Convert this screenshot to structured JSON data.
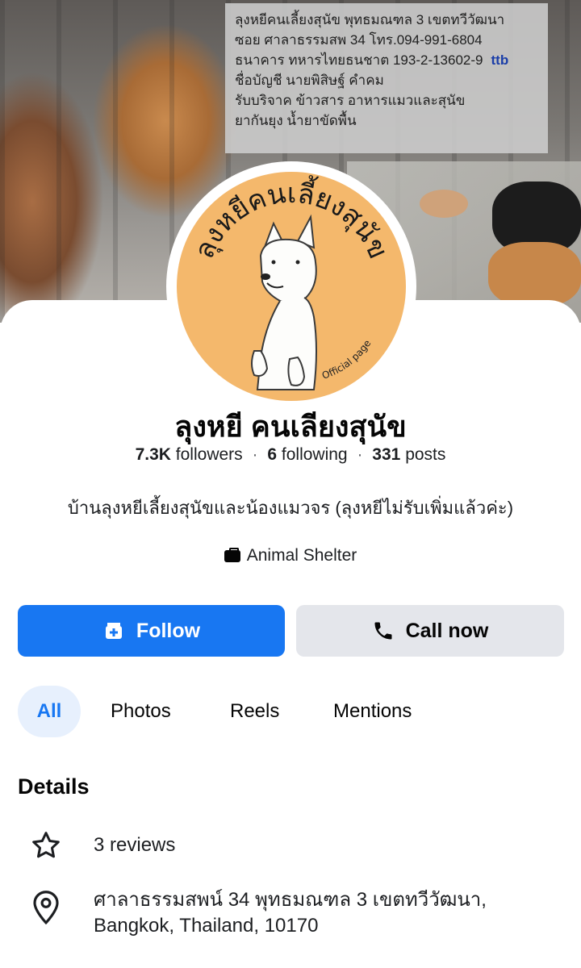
{
  "cover": {
    "lines": [
      "ลุงหยีคนเลี้ยงสุนัข พุทธมณฑล 3 เขตทวีวัฒนา",
      "ซอย ศาลาธรรมสพ 34 โทร.094-991-6804",
      "ธนาคาร ทหารไทยธนชาต 193-2-13602-9",
      "ชื่อบัญชี นายพิสิษฐ์ คำคม",
      "รับบริจาค ข้าวสาร อาหารแมวและสุนัข",
      "ยากันยุง น้ำยาขัดพื้น"
    ],
    "bank_logo": "ttb"
  },
  "avatar": {
    "arc_text": "ลุงหยีคนเลี้ยงสุนัข",
    "badge_text": "Official page",
    "background_color": "#f4b86c"
  },
  "profile": {
    "name": "ลุงหยี คนเลียงสุนัข",
    "followers": "7.3K",
    "followers_label": "followers",
    "following": "6",
    "following_label": "following",
    "posts": "331",
    "posts_label": "posts",
    "bio": "บ้านลุงหยีเลี้ยงสุนัขและน้องแมวจร (ลุงหยีไม่รับเพิ่มแล้วค่ะ)",
    "category": "Animal Shelter"
  },
  "actions": {
    "follow_label": "Follow",
    "call_label": "Call now",
    "follow_color": "#1877f2"
  },
  "tabs": [
    {
      "label": "All",
      "active": true
    },
    {
      "label": "Photos",
      "active": false
    },
    {
      "label": "Reels",
      "active": false
    },
    {
      "label": "Mentions",
      "active": false
    }
  ],
  "details": {
    "title": "Details",
    "reviews": "3 reviews",
    "address_line1": "ศาลาธรรมสพน์ 34 พุทธมณฑล 3 เขตทวีวัฒนา,",
    "address_line2": "Bangkok, Thailand, 10170"
  },
  "icons": [
    "category-icon",
    "page-follow-icon",
    "phone-icon",
    "star-icon",
    "location-pin-icon"
  ]
}
